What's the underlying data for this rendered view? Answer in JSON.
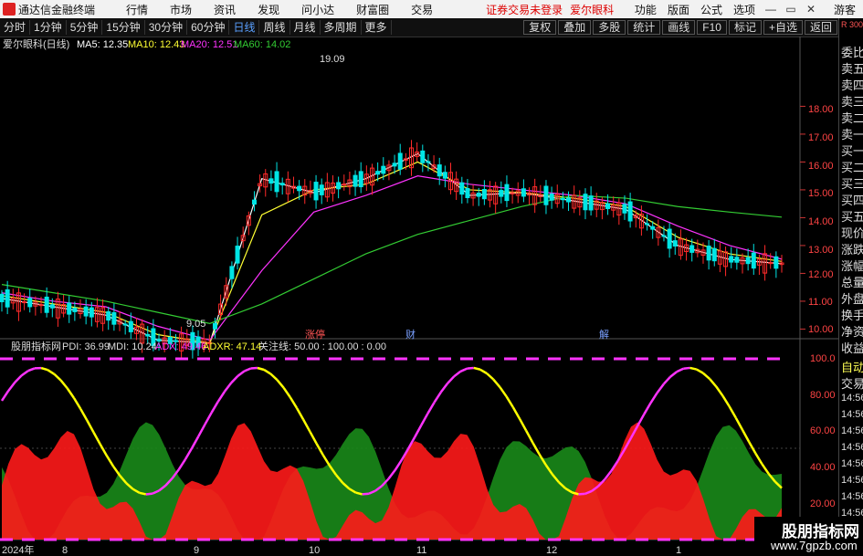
{
  "menubar": {
    "app_title": "通达信金融终端",
    "items": [
      "行情",
      "市场",
      "资讯",
      "发现",
      "问小达",
      "财富圈",
      "交易"
    ],
    "warning": "证券交易未登录",
    "stock_name": "爱尔眼科",
    "right_items": [
      "功能",
      "版面",
      "公式",
      "选项"
    ],
    "user": "游客",
    "win_buttons": [
      "—",
      "▭",
      "✕"
    ]
  },
  "toolbar": {
    "periods": [
      "分时",
      "1分钟",
      "5分钟",
      "15分钟",
      "30分钟",
      "60分钟",
      "日线",
      "周线",
      "月线",
      "多周期",
      "更多"
    ],
    "selected": "日线",
    "tools": [
      "复权",
      "叠加",
      "多股",
      "统计",
      "画线",
      "F10",
      "标记",
      "+自选",
      "返回"
    ],
    "count_badge": "R 300"
  },
  "main_chart": {
    "header": {
      "title": "爱尔眼科(日线)",
      "ma5": "MA5: 12.35",
      "ma10": "MA10: 12.43",
      "ma20": "MA20: 12.51",
      "ma60": "MA60: 14.02"
    },
    "high_label": "19.09",
    "low_label": "9.05",
    "event_labels": [
      "涨停",
      "财",
      "解"
    ],
    "y_ticks": [
      "18.00",
      "17.00",
      "16.00",
      "15.00",
      "14.00",
      "13.00",
      "12.00",
      "11.00",
      "10.00"
    ]
  },
  "indicator": {
    "header": {
      "name": "股朋指标网",
      "pdi": "PDI: 36.99",
      "mdi": "MDI: 10.24",
      "adx": "ADX: 49.46",
      "adxr": "ADXR: 47.14",
      "focus": "关注线: 50.00 : 100.00 : 0.00"
    },
    "y_ticks": [
      "100.0",
      "80.00",
      "60.00",
      "40.00",
      "20.00"
    ]
  },
  "x_axis": {
    "labels": [
      "2024年",
      "8",
      "9",
      "10",
      "11",
      "12",
      "1"
    ]
  },
  "right_panel": {
    "labels": [
      "委比",
      "卖五",
      "卖四",
      "卖三",
      "卖二",
      "卖一",
      "买一",
      "买二",
      "买三",
      "买四",
      "买五",
      "现价",
      "涨跌",
      "涨幅",
      "总量",
      "外盘",
      "换手",
      "净资",
      "收益"
    ],
    "auto": "自动",
    "trade": "交易",
    "times": [
      "14:56",
      "14:56",
      "14:56",
      "14:56",
      "14:56",
      "14:56",
      "14:56",
      "14:56"
    ]
  },
  "watermark": {
    "name": "股朋指标网",
    "url": "www.7gpzb.com"
  },
  "colors": {
    "up": "#ff2a2a",
    "down": "#00e5e5",
    "ma5": "#ffffff",
    "ma10": "#ffff33",
    "ma20": "#ff33ff",
    "ma60": "#33cc33",
    "pdi_area": "#ff1a1a",
    "mdi_area": "#1a8a1a",
    "adx_up": "#ff33ff",
    "adx_down": "#ffff00"
  },
  "chart_data": {
    "type": "line",
    "title": "爱尔眼科(日线)",
    "ylim": [
      9.0,
      19.5
    ],
    "x": [
      "2024-07",
      "2024-08",
      "2024-09",
      "2024-10",
      "2024-11",
      "2024-12",
      "2025-01"
    ],
    "series": [
      {
        "name": "MA5",
        "values": [
          11.1,
          10.8,
          10.5,
          9.6,
          9.5,
          15.4,
          14.9,
          15.4,
          16.3,
          14.8,
          14.9,
          14.6,
          14.3,
          13.0,
          12.5,
          12.35
        ]
      },
      {
        "name": "MA10",
        "values": [
          11.2,
          10.9,
          10.6,
          9.8,
          9.5,
          14.1,
          15.0,
          15.2,
          16.0,
          15.0,
          14.9,
          14.7,
          14.4,
          13.3,
          12.7,
          12.43
        ]
      },
      {
        "name": "MA20",
        "values": [
          11.3,
          11.0,
          10.8,
          10.1,
          9.6,
          12.1,
          14.2,
          14.8,
          15.5,
          15.2,
          15.0,
          14.8,
          14.5,
          13.7,
          13.0,
          12.51
        ]
      },
      {
        "name": "MA60",
        "values": [
          11.6,
          11.3,
          11.0,
          10.6,
          10.2,
          10.9,
          11.8,
          12.7,
          13.4,
          13.9,
          14.4,
          14.8,
          14.7,
          14.4,
          14.2,
          14.02
        ]
      }
    ]
  }
}
